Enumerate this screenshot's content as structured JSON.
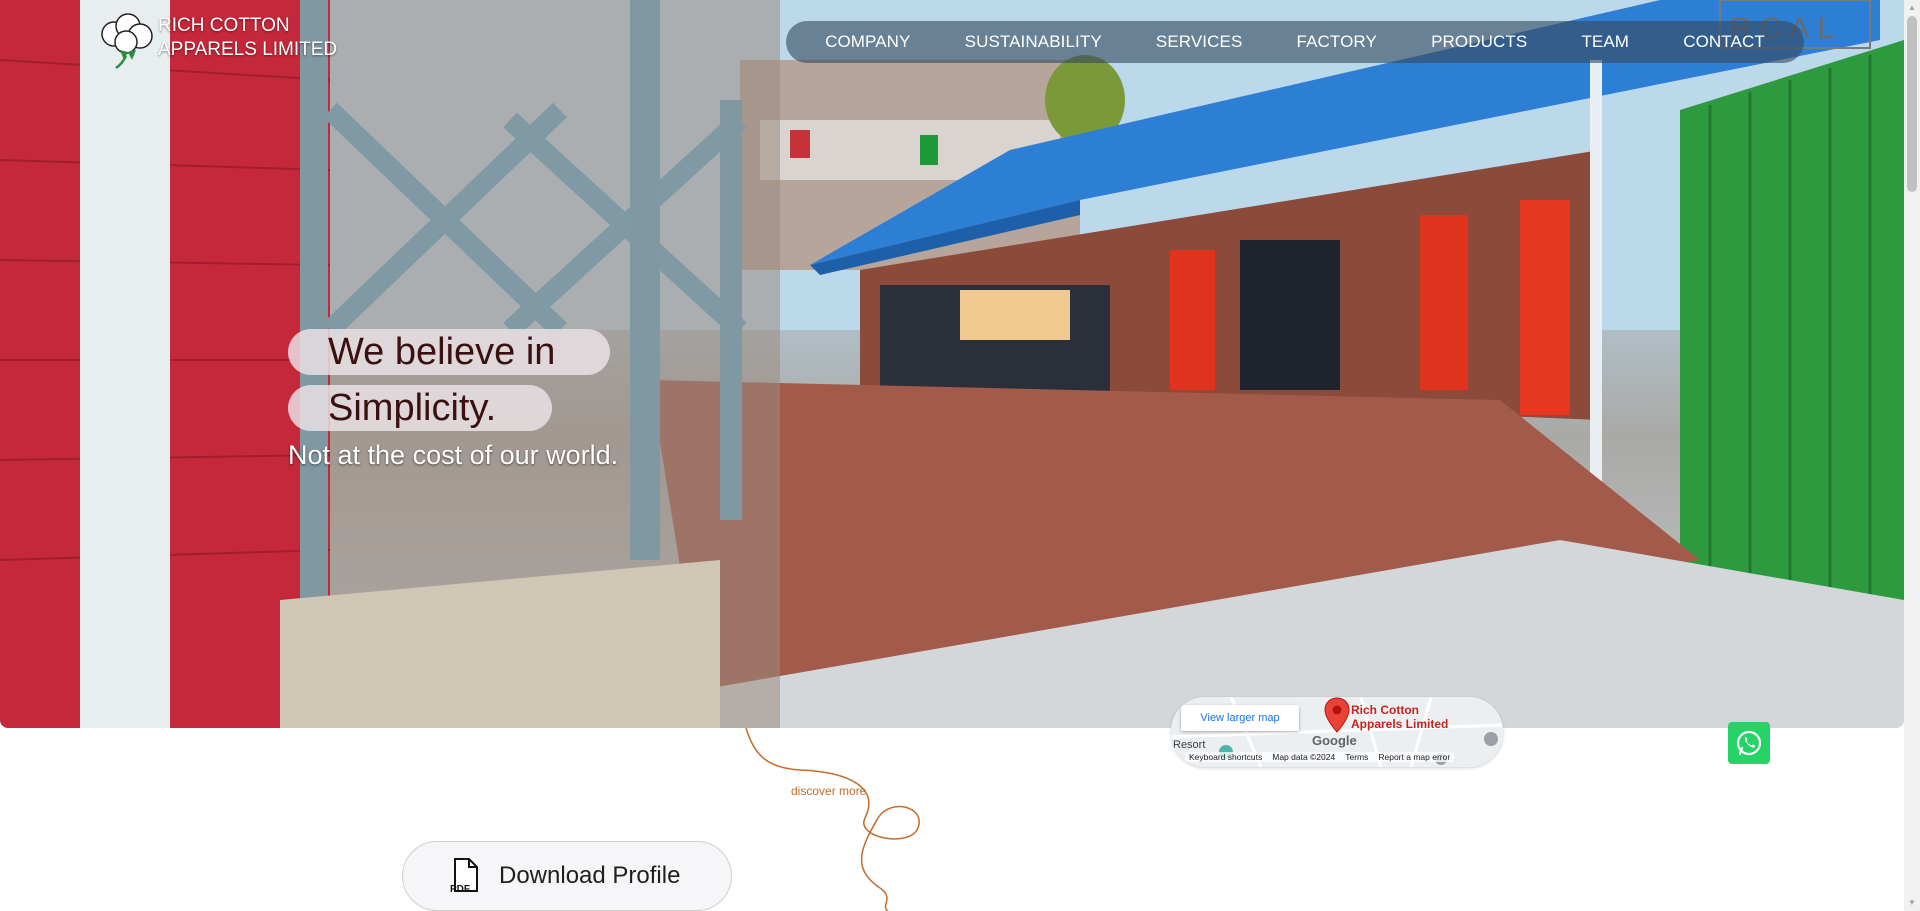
{
  "brand": {
    "name_line1": "RICH COTTON",
    "name_line2": "APPARELS LIMITED",
    "logo_icon": "cotton-flower-icon"
  },
  "nav": {
    "items": [
      {
        "label": "COMPANY"
      },
      {
        "label": "SUSTAINABILITY"
      },
      {
        "label": "SERVICES"
      },
      {
        "label": "FACTORY"
      },
      {
        "label": "PRODUCTS"
      },
      {
        "label": "TEAM"
      },
      {
        "label": "CONTACT"
      }
    ]
  },
  "hero": {
    "headline_line1": "We believe in",
    "headline_line2": "Simplicity.",
    "tagline": "Not at the cost of our world.",
    "building_sign": "RCAL"
  },
  "discover": {
    "label": "discover more"
  },
  "download": {
    "label": "Download Profile",
    "icon": "pdf-file-icon",
    "icon_text": "PDF"
  },
  "map": {
    "larger_map_label": "View larger map",
    "place_name_line1": "Rich Cotton",
    "place_name_line2": "Apparels Limited",
    "nearby_label": "Resort",
    "provider": "Google",
    "footer": {
      "shortcuts": "Keyboard shortcuts",
      "map_data": "Map data ©2024",
      "terms": "Terms",
      "report": "Report a map error"
    }
  },
  "whatsapp": {
    "icon": "whatsapp-icon"
  },
  "colors": {
    "nav_bg": "#374b5f",
    "accent_orange": "#c46a2a",
    "whatsapp_green": "#25d366",
    "headline_text": "#3a1010"
  }
}
